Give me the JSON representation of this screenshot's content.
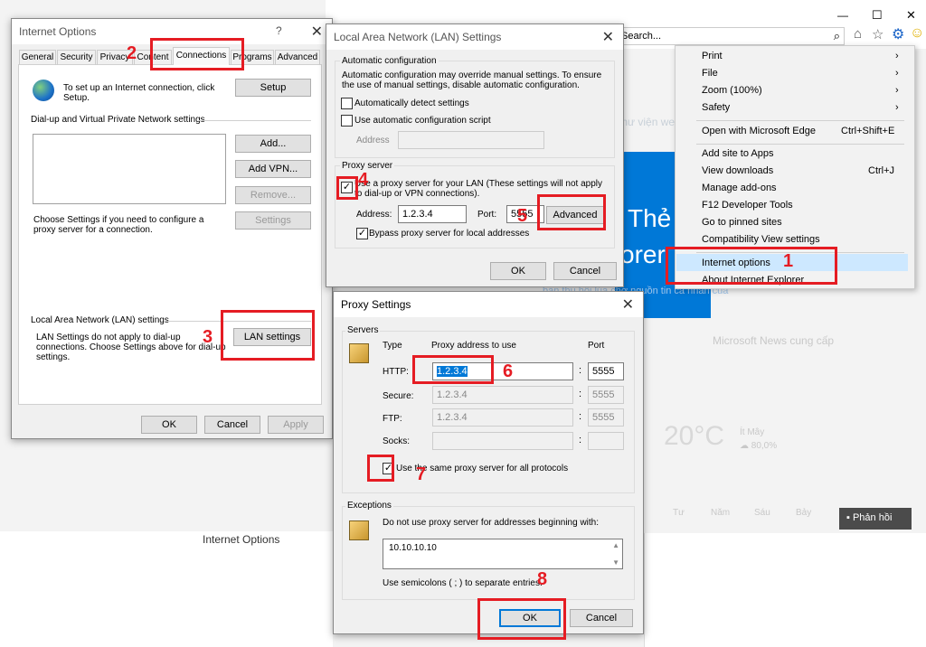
{
  "browser": {
    "search_placeholder": "Search...",
    "search_glyph": "⌕",
    "minimize": "—",
    "maximize": "☐",
    "close": "✕",
    "home_icon": "⌂",
    "star_icon": "☆",
    "gear_icon": "⚙",
    "smiley_icon": "☺",
    "bg_snippets": {
      "thu_vien": "Thư viện web",
      "the": "Thẻ",
      "orer": "orer",
      "phrase": "bạn thu hồi lúa chợ nguồn tin cá nhân của",
      "ms_news": "Microsoft News cung cấp",
      "temp": "20°C",
      "weather1": "Ít Mây",
      "weather2": "☁ 80,0%",
      "days": [
        "Tư",
        "Năm",
        "Sáu",
        "Bảy"
      ],
      "feedback": "Phản hồi",
      "bottom_title": "Internet Options"
    }
  },
  "menu": {
    "items": [
      {
        "label": "Print",
        "arrow": "›"
      },
      {
        "label": "File",
        "arrow": "›"
      },
      {
        "label": "Zoom (100%)",
        "arrow": "›"
      },
      {
        "label": "Safety",
        "arrow": "›"
      },
      {
        "label": "Open with Microsoft Edge",
        "shortcut": "Ctrl+Shift+E"
      },
      {
        "label": "Add site to Apps"
      },
      {
        "label": "View downloads",
        "shortcut": "Ctrl+J"
      },
      {
        "label": "Manage add-ons"
      },
      {
        "label": "F12 Developer Tools"
      },
      {
        "label": "Go to pinned sites"
      },
      {
        "label": "Compatibility View settings"
      },
      {
        "label": "Internet options"
      },
      {
        "label": "About Internet Explorer"
      }
    ]
  },
  "internet_options": {
    "title": "Internet Options",
    "help": "?",
    "close": "✕",
    "tabs": [
      "General",
      "Security",
      "Privacy",
      "Content",
      "Connections",
      "Programs",
      "Advanced"
    ],
    "setup_text": "To set up an Internet connection, click Setup.",
    "setup_button": "Setup",
    "dialup_group": "Dial-up and Virtual Private Network settings",
    "add_button": "Add...",
    "add_vpn_button": "Add VPN...",
    "remove_button": "Remove...",
    "settings_button": "Settings",
    "choose_text": "Choose Settings if you need to configure a proxy server for a connection.",
    "lan_group": "Local Area Network (LAN) settings",
    "lan_text": "LAN Settings do not apply to dial-up connections. Choose Settings above for dial-up settings.",
    "lan_button": "LAN settings",
    "ok": "OK",
    "cancel": "Cancel",
    "apply": "Apply"
  },
  "lan": {
    "title": "Local Area Network (LAN) Settings",
    "close": "✕",
    "auto_group": "Automatic configuration",
    "auto_text": "Automatic configuration may override manual settings.  To ensure the use of manual settings, disable automatic configuration.",
    "auto_detect": "Automatically detect settings",
    "auto_script": "Use automatic configuration script",
    "address_label": "Address",
    "proxy_group": "Proxy server",
    "proxy_text": "Use a proxy server for your LAN (These settings will not apply to dial-up or VPN connections).",
    "address2_label": "Address:",
    "address_value": "1.2.3.4",
    "port_label": "Port:",
    "port_value": "5555",
    "advanced_button": "Advanced",
    "bypass": "Bypass proxy server for local addresses",
    "ok": "OK",
    "cancel": "Cancel"
  },
  "proxy": {
    "title": "Proxy Settings",
    "close": "✕",
    "servers_group": "Servers",
    "type_header": "Type",
    "address_header": "Proxy address to use",
    "port_header": "Port",
    "rows": [
      {
        "type": "HTTP:",
        "address": "1.2.3.4",
        "port": "5555"
      },
      {
        "type": "Secure:",
        "address": "1.2.3.4",
        "port": "5555"
      },
      {
        "type": "FTP:",
        "address": "1.2.3.4",
        "port": "5555"
      },
      {
        "type": "Socks:",
        "address": "",
        "port": ""
      }
    ],
    "colon": ":",
    "same_proxy": "Use the same proxy server for all protocols",
    "exceptions_group": "Exceptions",
    "exceptions_text": "Do not use proxy server for addresses beginning with:",
    "exceptions_value": "10.10.10.10",
    "semicolon_text": "Use semicolons ( ; ) to separate entries.",
    "ok": "OK",
    "cancel": "Cancel"
  },
  "steps": [
    "1",
    "2",
    "3",
    "4",
    "5",
    "6",
    "7",
    "8"
  ]
}
